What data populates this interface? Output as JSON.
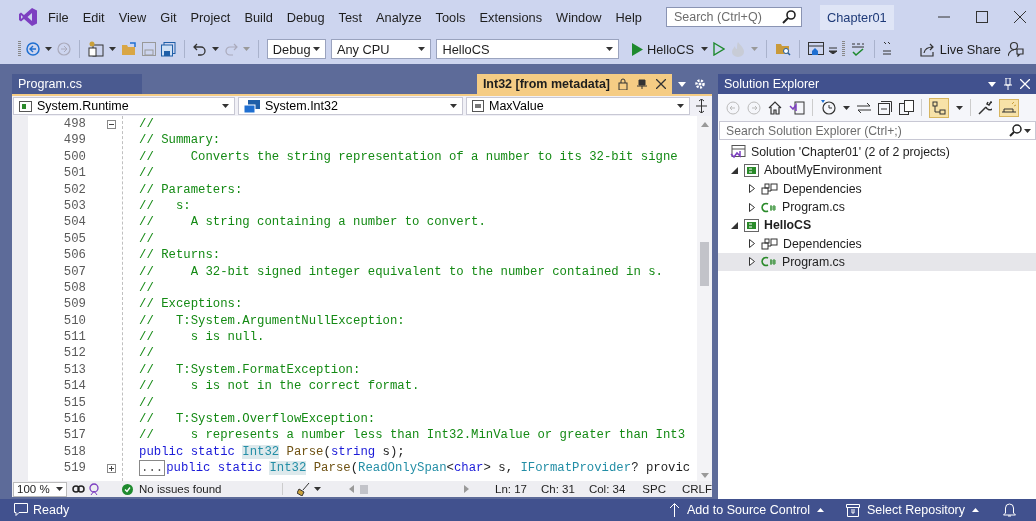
{
  "title_bar": {
    "menu": [
      "File",
      "Edit",
      "View",
      "Git",
      "Project",
      "Build",
      "Debug",
      "Test",
      "Analyze",
      "Tools",
      "Extensions",
      "Window",
      "Help"
    ],
    "search": {
      "placeholder": "Search (Ctrl+Q)"
    },
    "solution_name": "Chapter01"
  },
  "toolbar": {
    "configuration": "Debug",
    "platform": "Any CPU",
    "startup_project": "HelloCS",
    "run_button": "HelloCS",
    "live_share": "Live Share"
  },
  "editor": {
    "tabs": [
      {
        "label": "Program.cs",
        "selected": false
      },
      {
        "label": "Int32 [from metadata]",
        "selected": true
      }
    ],
    "navigation": [
      "System.Runtime",
      "System.Int32",
      "MaxValue"
    ],
    "lines": [
      {
        "number": "498",
        "expanded": true,
        "tokens": [
          {
            "kind": "comment",
            "text": "//"
          }
        ]
      },
      {
        "number": "499",
        "tokens": [
          {
            "kind": "comment",
            "text": "// Summary:"
          }
        ]
      },
      {
        "number": "500",
        "tokens": [
          {
            "kind": "comment",
            "text": "//     Converts the string representation of a number to its 32-bit signe"
          }
        ]
      },
      {
        "number": "501",
        "tokens": [
          {
            "kind": "comment",
            "text": "//"
          }
        ]
      },
      {
        "number": "502",
        "tokens": [
          {
            "kind": "comment",
            "text": "// Parameters:"
          }
        ]
      },
      {
        "number": "503",
        "tokens": [
          {
            "kind": "comment",
            "text": "//   s:"
          }
        ]
      },
      {
        "number": "504",
        "tokens": [
          {
            "kind": "comment",
            "text": "//     A string containing a number to convert."
          }
        ]
      },
      {
        "number": "505",
        "tokens": [
          {
            "kind": "comment",
            "text": "//"
          }
        ]
      },
      {
        "number": "506",
        "tokens": [
          {
            "kind": "comment",
            "text": "// Returns:"
          }
        ]
      },
      {
        "number": "507",
        "tokens": [
          {
            "kind": "comment",
            "text": "//     A 32-bit signed integer equivalent to the number contained in s."
          }
        ]
      },
      {
        "number": "508",
        "tokens": [
          {
            "kind": "comment",
            "text": "//"
          }
        ]
      },
      {
        "number": "509",
        "tokens": [
          {
            "kind": "comment",
            "text": "// Exceptions:"
          }
        ]
      },
      {
        "number": "510",
        "tokens": [
          {
            "kind": "comment",
            "text": "//   T:System.ArgumentNullException:"
          }
        ]
      },
      {
        "number": "511",
        "tokens": [
          {
            "kind": "comment",
            "text": "//     s is null."
          }
        ]
      },
      {
        "number": "512",
        "tokens": [
          {
            "kind": "comment",
            "text": "//"
          }
        ]
      },
      {
        "number": "513",
        "tokens": [
          {
            "kind": "comment",
            "text": "//   T:System.FormatException:"
          }
        ]
      },
      {
        "number": "514",
        "tokens": [
          {
            "kind": "comment",
            "text": "//     s is not in the correct format."
          }
        ]
      },
      {
        "number": "515",
        "tokens": [
          {
            "kind": "comment",
            "text": "//"
          }
        ]
      },
      {
        "number": "516",
        "tokens": [
          {
            "kind": "comment",
            "text": "//   T:System.OverflowException:"
          }
        ]
      },
      {
        "number": "517",
        "tokens": [
          {
            "kind": "comment",
            "text": "//     s represents a number less than Int32.MinValue or greater than Int3"
          }
        ]
      },
      {
        "number": "518",
        "tokens": [
          {
            "kind": "keyword",
            "text": "public static "
          },
          {
            "kind": "highlight",
            "text": "Int32"
          },
          {
            "kind": "method",
            "text": " Parse"
          },
          {
            "kind": "plain",
            "text": "("
          },
          {
            "kind": "keyword",
            "text": "string"
          },
          {
            "kind": "plain",
            "text": " s);"
          }
        ]
      },
      {
        "number": "519",
        "expanded": false,
        "tokens": [
          {
            "kind": "collapsed",
            "text": "..."
          },
          {
            "kind": "keyword",
            "text": "public static "
          },
          {
            "kind": "highlight",
            "text": "Int32"
          },
          {
            "kind": "method",
            "text": " Parse"
          },
          {
            "kind": "plain",
            "text": "("
          },
          {
            "kind": "type",
            "text": "ReadOnlySpan"
          },
          {
            "kind": "plain",
            "text": "<"
          },
          {
            "kind": "keyword",
            "text": "char"
          },
          {
            "kind": "plain",
            "text": "> s, "
          },
          {
            "kind": "type",
            "text": "IFormatProvider"
          },
          {
            "kind": "plain",
            "text": "? provic"
          }
        ]
      }
    ],
    "status": {
      "zoom": "100 %",
      "issues": "No issues found",
      "line": "Ln: 17",
      "char": "Ch: 31",
      "column": "Col: 34",
      "whitespace": "SPC",
      "line_ending": "CRLF"
    }
  },
  "solution_explorer": {
    "title": "Solution Explorer",
    "search": {
      "placeholder": "Search Solution Explorer (Ctrl+;)"
    },
    "tree": [
      {
        "kind": "solution",
        "label": "Solution 'Chapter01' (2 of 2 projects)",
        "selected": false,
        "children": [
          {
            "kind": "project",
            "label": "AboutMyEnvironment",
            "startup": false,
            "expanded": true,
            "selected": false,
            "children": [
              {
                "kind": "dependencies",
                "label": "Dependencies",
                "expanded": false,
                "selected": false
              },
              {
                "kind": "file",
                "label": "Program.cs",
                "expanded": false,
                "selected": false
              }
            ]
          },
          {
            "kind": "project",
            "label": "HelloCS",
            "startup": true,
            "expanded": true,
            "selected": false,
            "children": [
              {
                "kind": "dependencies",
                "label": "Dependencies",
                "expanded": false,
                "selected": false
              },
              {
                "kind": "file",
                "label": "Program.cs",
                "expanded": false,
                "selected": true
              }
            ]
          }
        ]
      }
    ]
  },
  "status_bar": {
    "state": "Ready",
    "source_control": "Add to Source Control",
    "repository": "Select Repository"
  }
}
